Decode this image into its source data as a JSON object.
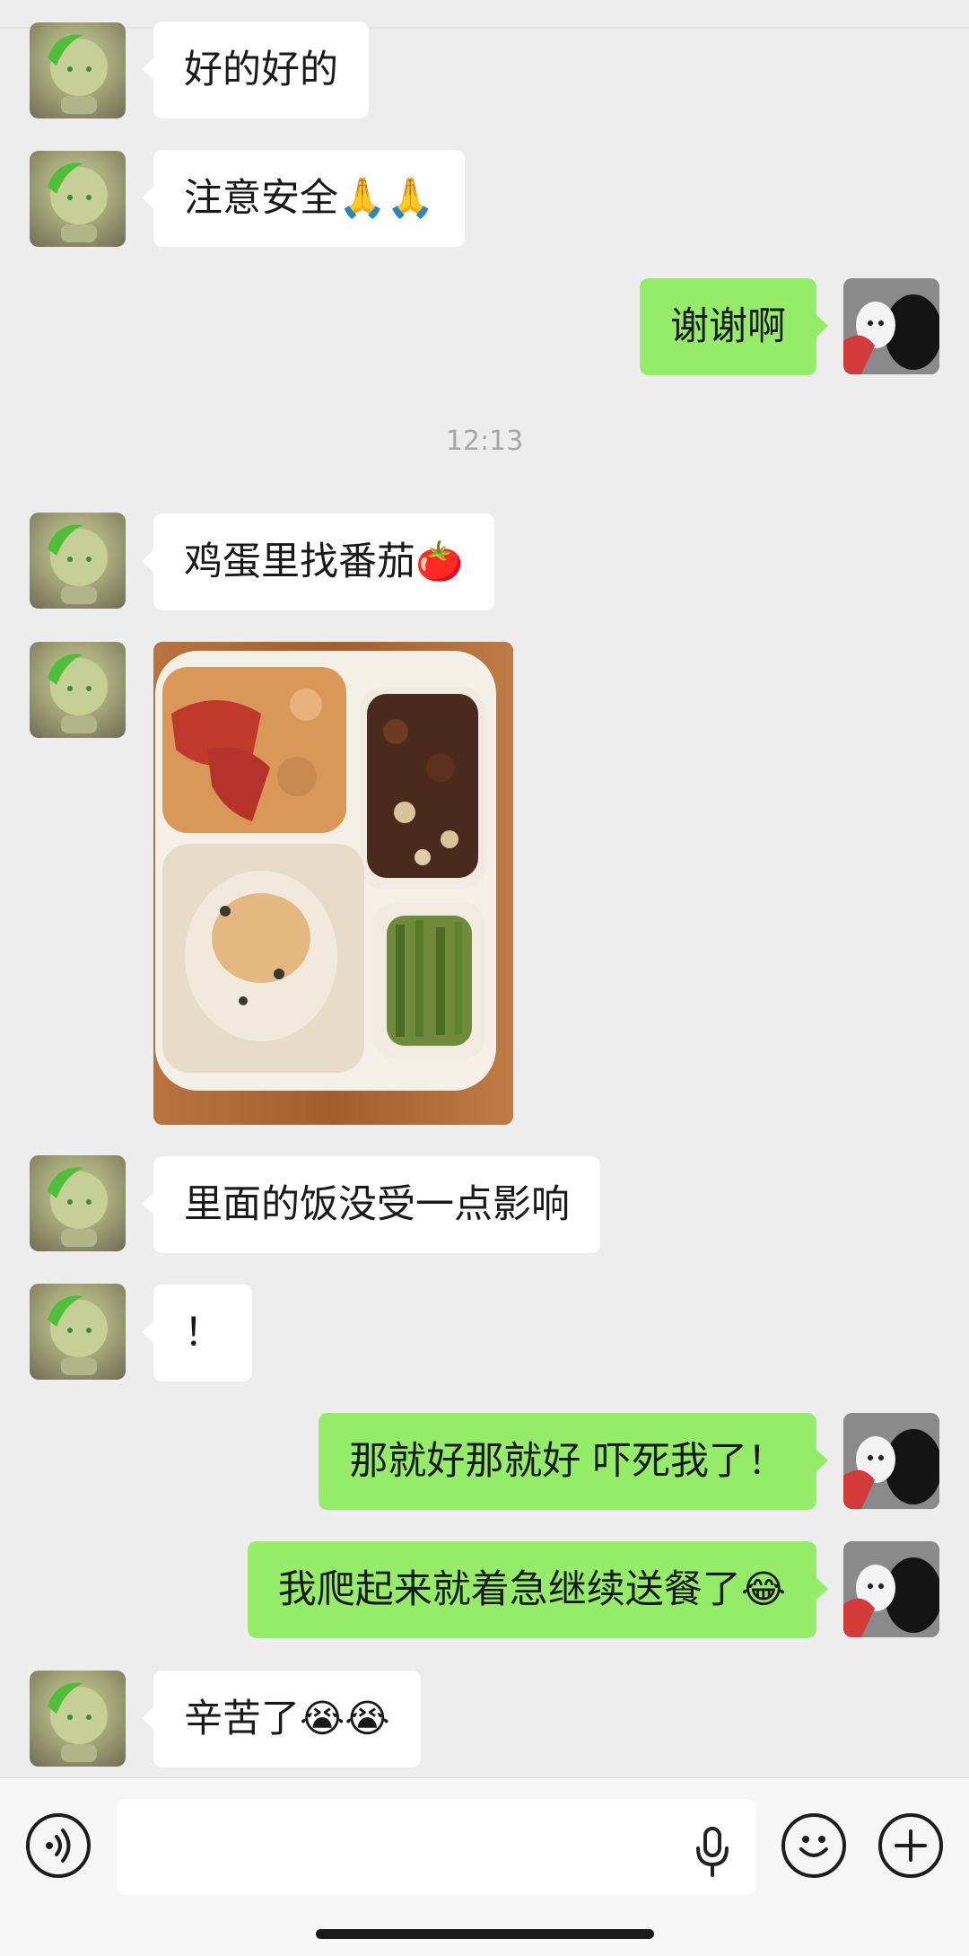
{
  "messages": [
    {
      "side": "left",
      "text": "好的好的"
    },
    {
      "side": "left",
      "text": "注意安全🙏🙏"
    },
    {
      "side": "right",
      "text": "谢谢啊"
    },
    {
      "side": "left",
      "text": "鸡蛋里找番茄🍅"
    },
    {
      "side": "left",
      "text": "里面的饭没受一点影响"
    },
    {
      "side": "left",
      "text": "！"
    },
    {
      "side": "right",
      "text": "那就好那就好 吓死我了！"
    },
    {
      "side": "right",
      "text": "我爬起来就着急继续送餐了😂"
    },
    {
      "side": "left",
      "text": "辛苦了😭😭"
    }
  ],
  "timestamp": "12:13",
  "input": {
    "value": "",
    "placeholder": ""
  },
  "icons": {
    "voice": "voice-wave-icon",
    "mic": "microphone-icon",
    "emoji": "smiley-face-icon",
    "more": "plus-icon"
  },
  "colors": {
    "background": "#ededed",
    "left_bubble": "#ffffff",
    "right_bubble": "#95ec69",
    "timestamp_text": "#a7a7a7"
  }
}
